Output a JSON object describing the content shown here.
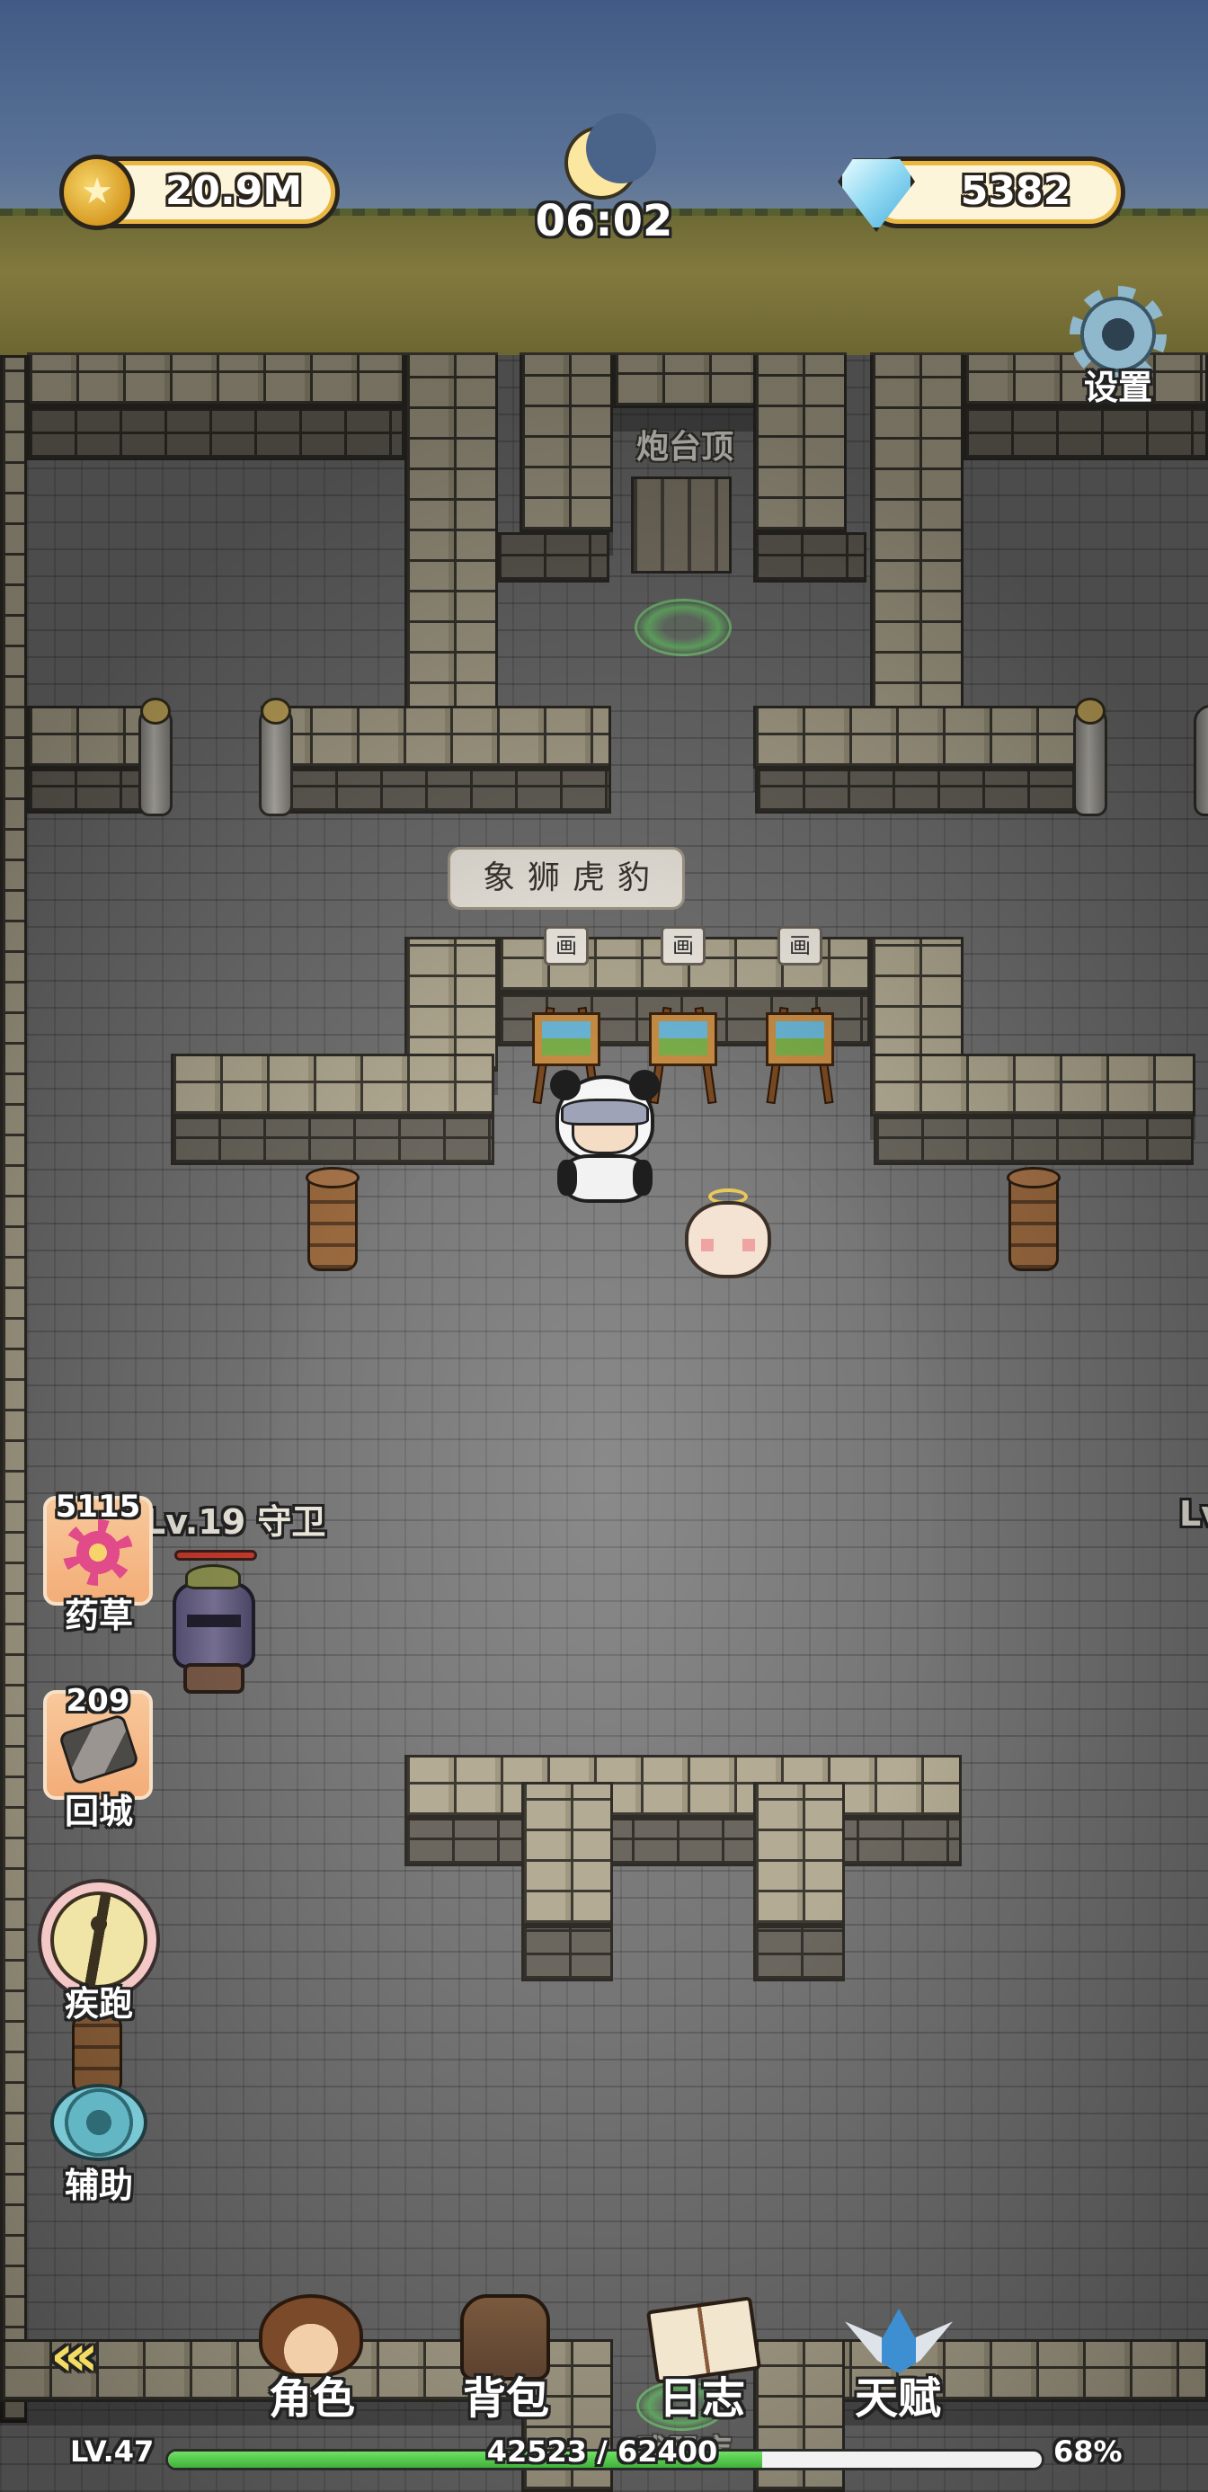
{
  "hud": {
    "gold": "20.9M",
    "gems": "5382",
    "clock": "06:02",
    "settings_label": "设置"
  },
  "map": {
    "area_label": "炮台顶",
    "bottom_label": "武器库",
    "sign_text": "象狮虎豹",
    "painting_labels": [
      "画",
      "画",
      "画"
    ],
    "guard_label": "Lv.19 守卫",
    "right_edge_label": "Lv"
  },
  "side_buttons": {
    "herb_count": "5115",
    "herb_label": "药草",
    "scroll_count": "209",
    "scroll_label": "回城",
    "sprint_label": "疾跑",
    "assist_label": "辅助"
  },
  "bottom_nav": {
    "back_icon": "double-chevron-left-icon",
    "items": [
      "角色",
      "背包",
      "日志",
      "天赋"
    ]
  },
  "xp": {
    "level": "LV.47",
    "current": "42523 / 62400",
    "percent_text": "68%",
    "fill_fraction": 0.68
  }
}
